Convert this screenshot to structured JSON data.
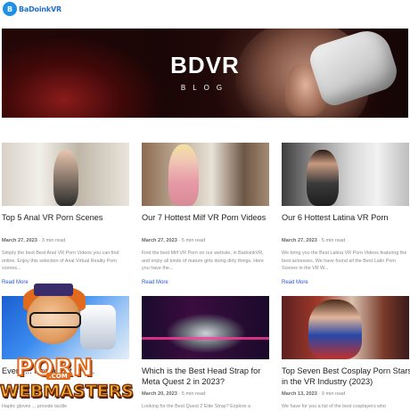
{
  "header": {
    "logo_badge": "B",
    "logo_text": "BaDoinkVR"
  },
  "hero": {
    "title": "BDVR",
    "subtitle": "BLOG"
  },
  "posts": [
    {
      "title": "Top 5 Anal VR Porn Scenes",
      "date": "March 27, 2023",
      "read_time": "3 min read",
      "excerpt": "Simply the best Best Anal VR Porn Videos you can find online. Enjoy this selection of Anal Virtual Reality Porn scenes...",
      "read_more": "Read More"
    },
    {
      "title": "Our 7 Hottest Milf VR Porn Videos",
      "date": "March 27, 2023",
      "read_time": "5 min read",
      "excerpt": "Find the best Milf VR Porn on our website, in BadoinkVR, and enjoy all kinds of mature girls doing dirty things. Here you have the...",
      "read_more": "Read More"
    },
    {
      "title": "Our 6 Hottest Latina VR Porn",
      "date": "March 27, 2023",
      "read_time": "5 min read",
      "excerpt": "We bring you the Best Latina VR Porn Videos featuring the best actresses. We have found all the Best Latin Porn Scenes in the VR W...",
      "read_more": "Read More"
    },
    {
      "title": "Every ... now about VR ...",
      "date": "",
      "read_time": "",
      "excerpt": "Haptic gloves ... provide tactile",
      "read_more": ""
    },
    {
      "title": "Which is the Best Head Strap for Meta Quest 2 in 2023?",
      "date": "March 20, 2023",
      "read_time": "5 min read",
      "excerpt": "Looking for the Best Quest 2 Elite Strap? Explore a",
      "read_more": ""
    },
    {
      "title": "Top Seven Best Cosplay Porn Stars in the VR Industry (2023)",
      "date": "March 13, 2023",
      "read_time": "9 min read",
      "excerpt": "We have for you a list of the best cosplayers who",
      "read_more": ""
    }
  ],
  "watermark": {
    "line1": "PORN",
    "line2": ".COM",
    "line3": "WEBMASTERS"
  },
  "colors": {
    "logo_blue": "#1e90e6",
    "link_blue": "#2a56c6",
    "watermark_orange": "#e06a1e",
    "watermark_gold": "#f7b733"
  }
}
